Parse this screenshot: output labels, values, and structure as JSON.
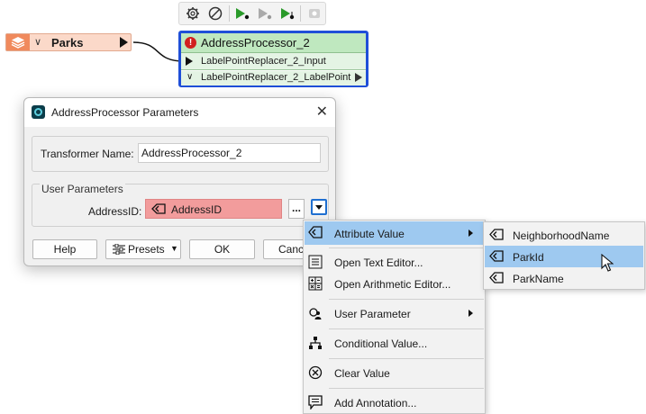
{
  "toolbar": {
    "icons": [
      "gear-icon",
      "disable-icon",
      "run-to-this-icon",
      "run-disabled-icon",
      "run-from-this-icon",
      "inspect-icon"
    ]
  },
  "reader": {
    "name": "Parks"
  },
  "transformer": {
    "title": "AddressProcessor_2",
    "input_port": "LabelPointReplacer_2_Input",
    "output_port": "LabelPointReplacer_2_LabelPoint"
  },
  "dialog": {
    "title": "AddressProcessor Parameters",
    "close": "✕",
    "transformer_name_label": "Transformer Name:",
    "transformer_name_value": "AddressProcessor_2",
    "user_parameters_title": "User Parameters",
    "param_label": "AddressID:",
    "param_value": "AddressID",
    "ellipsis": "...",
    "buttons": {
      "help": "Help",
      "presets": "Presets",
      "ok": "OK",
      "cancel": "Canc"
    }
  },
  "context_menu": {
    "items": [
      {
        "label": "Attribute Value",
        "icon": "attribute-icon",
        "submenu": true,
        "highlighted": true
      },
      {
        "label": "Open Text Editor...",
        "icon": "text-editor-icon"
      },
      {
        "label": "Open Arithmetic Editor...",
        "icon": "calculator-icon"
      },
      {
        "label": "User Parameter",
        "icon": "user-parameter-icon",
        "submenu": true
      },
      {
        "label": "Conditional Value...",
        "icon": "conditional-icon"
      },
      {
        "label": "Clear Value",
        "icon": "clear-icon"
      },
      {
        "label": "Add Annotation...",
        "icon": "annotation-icon"
      }
    ]
  },
  "submenu": {
    "items": [
      {
        "label": "NeighborhoodName"
      },
      {
        "label": "ParkId",
        "highlighted": true
      },
      {
        "label": "ParkName"
      }
    ]
  },
  "colors": {
    "transformer_border": "#1f4fd8",
    "transformer_header": "#bfe8bf",
    "reader_fill": "#fbd9c9",
    "attribute_field_fill": "#f29c9c",
    "menu_highlight": "#9ec9f0"
  }
}
